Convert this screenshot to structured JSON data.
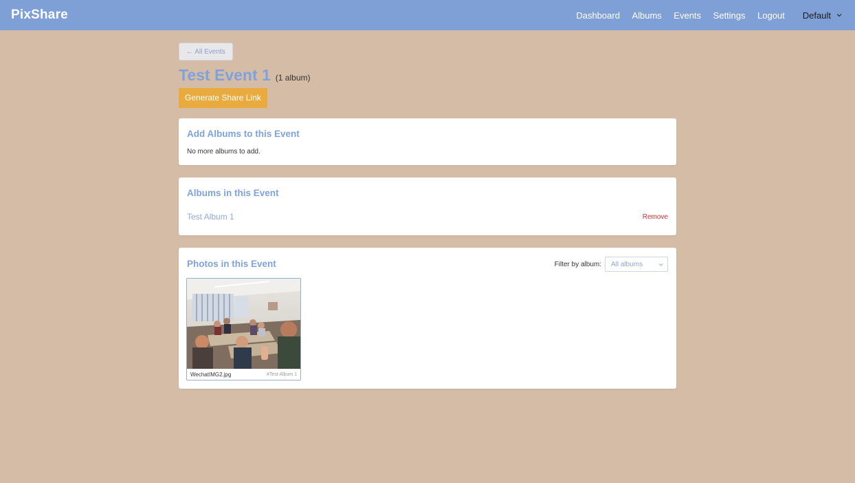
{
  "nav": {
    "brand": "PixShare",
    "links": [
      "Dashboard",
      "Albums",
      "Events",
      "Settings",
      "Logout"
    ],
    "theme": "Default"
  },
  "page": {
    "back_label": "← All Events",
    "event_title": "Test Event 1",
    "album_count": "(1 album)",
    "share_button": "Generate Share Link"
  },
  "add_albums": {
    "title": "Add Albums to this Event",
    "note": "No more albums to add."
  },
  "albums_in_event": {
    "title": "Albums in this Event",
    "items": [
      {
        "name": "Test Album 1",
        "action": "Remove"
      }
    ]
  },
  "photos": {
    "title": "Photos in this Event",
    "filter_label": "Filter by album:",
    "filter_value": "All albums",
    "items": [
      {
        "filename": "WechatIMG2.jpg",
        "album_tag": "#Test Album 1"
      }
    ]
  },
  "colors": {
    "navbar": "#7fa0d7",
    "background": "#d5bca6",
    "accent_blue": "#7ea3dc",
    "share_button": "#e9ab3e",
    "remove_red": "#d03030"
  }
}
